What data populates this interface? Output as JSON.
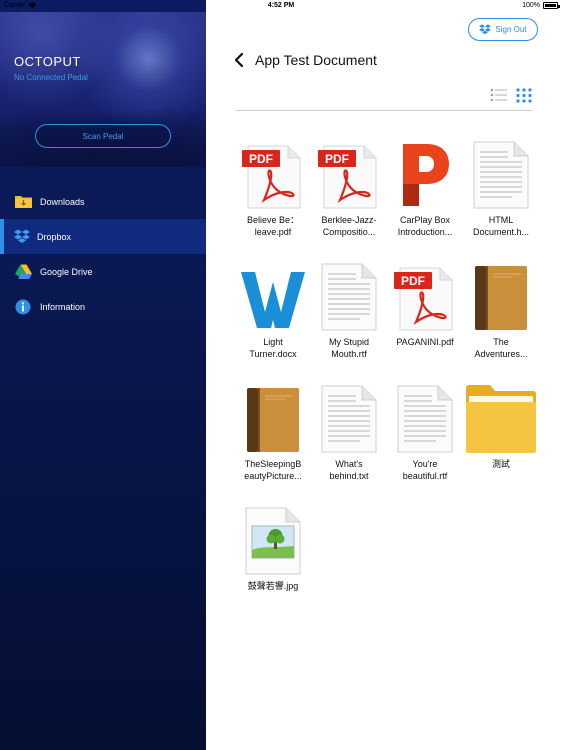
{
  "status_bar": {
    "carrier": "Carrier",
    "time": "4:52 PM",
    "battery": "100%"
  },
  "sidebar": {
    "app_name": "OCTOPUT",
    "pedal_status": "No Connected Pedal",
    "scan_button": "Scan Pedal",
    "items": [
      {
        "label": "Downloads",
        "icon": "folder-download-icon",
        "active": false
      },
      {
        "label": "Dropbox",
        "icon": "dropbox-icon",
        "active": true
      },
      {
        "label": "Google Drive",
        "icon": "google-drive-icon",
        "active": false
      },
      {
        "label": "Information",
        "icon": "info-icon",
        "active": false
      }
    ]
  },
  "header": {
    "sign_out": "Sign Out",
    "title": "App Test Document",
    "view_modes": [
      "list-view-icon",
      "grid-view-icon"
    ],
    "active_view": "grid"
  },
  "files": [
    {
      "name_line1": "Believe Be：",
      "name_line2": "leave.pdf",
      "type": "pdf"
    },
    {
      "name_line1": "Berklee-Jazz-",
      "name_line2": "Compositio...",
      "type": "pdf"
    },
    {
      "name_line1": "CarPlay Box",
      "name_line2": "Introduction...",
      "type": "pages"
    },
    {
      "name_line1": "HTML",
      "name_line2": "Document.h...",
      "type": "text"
    },
    {
      "name_line1": "Light",
      "name_line2": "Turner.docx",
      "type": "word"
    },
    {
      "name_line1": "My Stupid",
      "name_line2": "Mouth.rtf",
      "type": "text"
    },
    {
      "name_line1": "PAGANINI.pdf",
      "name_line2": "",
      "type": "pdf"
    },
    {
      "name_line1": "The",
      "name_line2": "Adventures...",
      "type": "book"
    },
    {
      "name_line1": "TheSleepingB",
      "name_line2": "eautyPicture...",
      "type": "book"
    },
    {
      "name_line1": "What's",
      "name_line2": "behind.txt",
      "type": "text"
    },
    {
      "name_line1": "You're",
      "name_line2": "beautiful.rtf",
      "type": "text"
    },
    {
      "name_line1": "測試",
      "name_line2": "",
      "type": "folder"
    },
    {
      "name_line1": "鼓聲若響.jpg",
      "name_line2": "",
      "type": "image"
    }
  ],
  "colors": {
    "accent": "#2f8fe6",
    "pdf_red": "#d9261c",
    "word_blue": "#1b8ed8",
    "pages_orange": "#e9441e",
    "folder_yellow": "#f5c542"
  }
}
